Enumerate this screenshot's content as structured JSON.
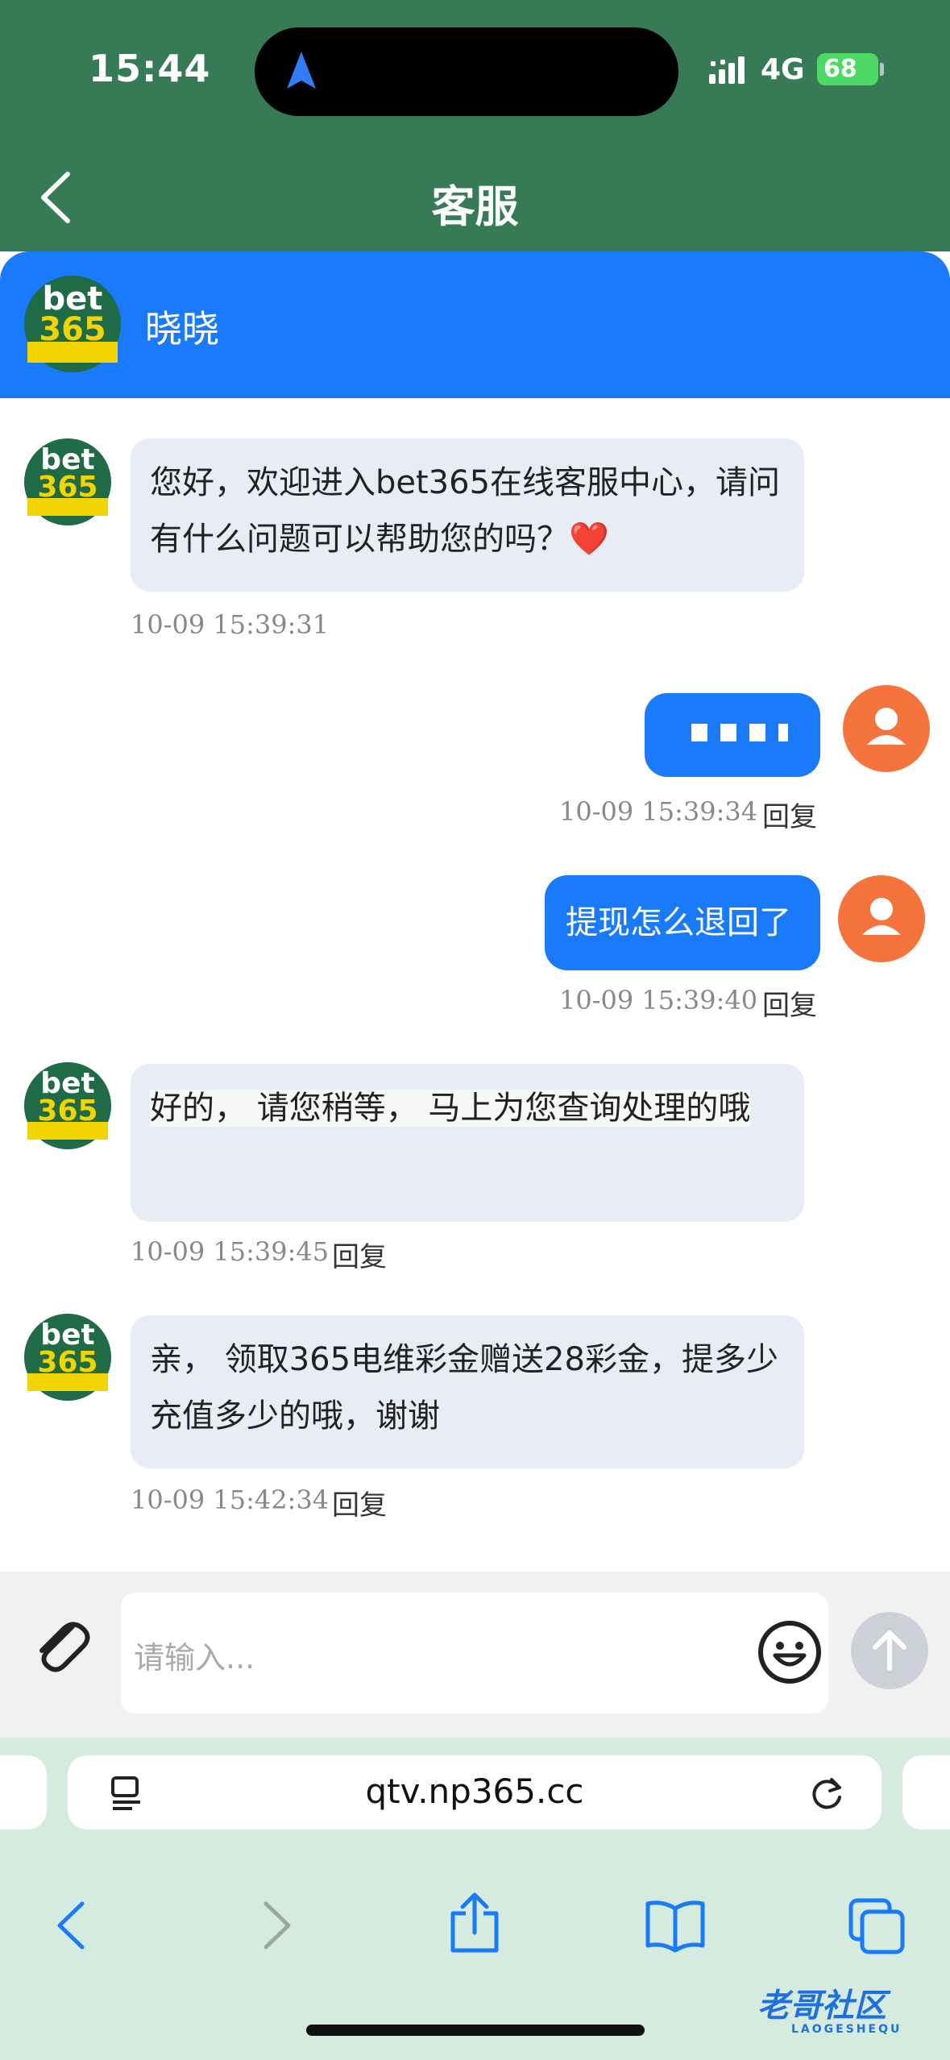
{
  "status_bar": {
    "time": "15:44",
    "network": "4G",
    "battery": "68"
  },
  "nav": {
    "title": "客服"
  },
  "agent": {
    "name": "晓晓",
    "logo_top": "bet",
    "logo_bottom": "365"
  },
  "messages": [
    {
      "from": "agent",
      "text": "您好，欢迎进入bet365在线客服中心，请问有什么问题可以帮助您的吗？",
      "emoji": "❤️",
      "time": "10-09 15:39:31"
    },
    {
      "from": "user",
      "text": "",
      "time": "10-09 15:39:34",
      "reply": "回复"
    },
    {
      "from": "user",
      "text": "提现怎么退回了",
      "time": "10-09 15:39:40",
      "reply": "回复"
    },
    {
      "from": "agent",
      "text": "好的， 请您稍等， 马上为您查询处理的哦",
      "time": "10-09 15:39:45",
      "reply": "回复"
    },
    {
      "from": "agent",
      "text": "亲， 领取365电维彩金赠送28彩金，提多少充值多少的哦，谢谢",
      "time": "10-09 15:42:34",
      "reply": "回复"
    }
  ],
  "composer": {
    "placeholder": "请输入..."
  },
  "browser": {
    "url": "qtv.np365.cc"
  },
  "watermark": {
    "text": "老哥社区",
    "sub": "LAOGESHEQU"
  },
  "colors": {
    "nav_bg": "#367a56",
    "agent_header": "#1a7afc",
    "user_bubble": "#1a7afc",
    "user_avatar": "#f5743e"
  },
  "icons": [
    "back-chevron-icon",
    "location-arrow-icon",
    "signal-icon",
    "paperclip-icon",
    "emoji-icon",
    "send-arrow-icon",
    "tabs-icon",
    "reload-icon",
    "browser-back-icon",
    "browser-forward-icon",
    "share-icon",
    "bookmarks-icon",
    "tabs-overview-icon"
  ]
}
